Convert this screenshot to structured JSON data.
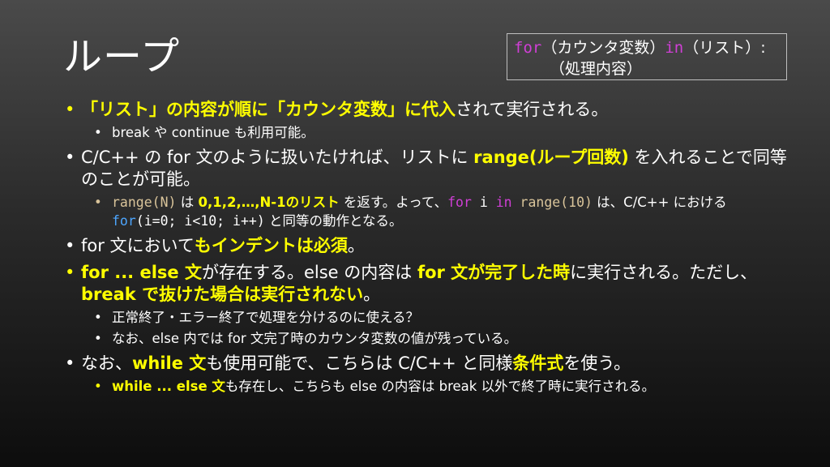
{
  "slide": {
    "title": "ループ"
  },
  "syntax_box": {
    "line1": {
      "kw_for": "for",
      "part1": "（カウンタ変数）",
      "kw_in": "in",
      "part2": "（リスト）:"
    },
    "line2": "（処理内容）"
  },
  "bullets": {
    "b1": {
      "t1": "「リスト」の内容が順に「カウンタ変数」に代入",
      "t2": "されて実行される。",
      "sub1": "break や continue も利用可能。"
    },
    "b2": {
      "t1": "C/C++ の for 文のように扱いたければ、リストに ",
      "t2": "range(ループ回数)",
      "t3": " を入れることで同等のことが可能。",
      "sub1": {
        "c1": "range(N)",
        "t1": " は ",
        "t2": "0,1,2,…,N-1のリスト",
        "t3": " を返す。よって、",
        "c2": "for",
        "c3": " i ",
        "c4": "in",
        "c5": " range(10)",
        "t4": " は、C/C++ における ",
        "c6": "for",
        "c7": "(i=0; i<10; i++)",
        "t5": " と同等の動作となる。"
      }
    },
    "b3": {
      "t1": "for 文において",
      "t2": "もインデントは必須",
      "t3": "。"
    },
    "b4": {
      "t1": "for ... else 文",
      "t2": "が存在する。else の内容は ",
      "t3": "for 文が完了した時",
      "t4": "に実行される。ただし、",
      "t5": "break で抜けた場合は実行されない",
      "t6": "。",
      "sub1": "正常終了・エラー終了で処理を分けるのに使える？",
      "sub2": "なお、else 内では for 文完了時のカウンタ変数の値が残っている。"
    },
    "b5": {
      "t1": "なお、",
      "t2": "while 文",
      "t3": "も使用可能で、こちらは C/C++ と同様",
      "t4": "条件式",
      "t5": "を使う。",
      "sub1": {
        "t1": "while ... else 文",
        "t2": "も存在し、こちらも else の内容は break 以外で終了時に実行される。"
      }
    }
  },
  "colors": {
    "highlight": "#ffff00",
    "keyword": "#d03fd6",
    "code_blue": "#4da6ff",
    "code_tan": "#d9c49a"
  }
}
